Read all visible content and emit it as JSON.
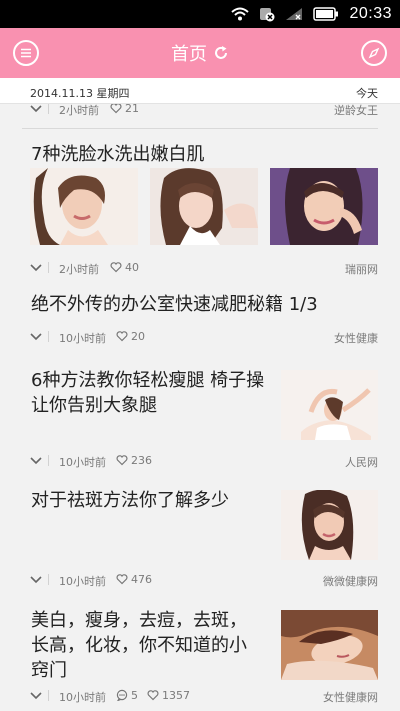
{
  "status_bar": {
    "time": "20:33",
    "icons": [
      "wifi-icon",
      "sim-off-icon",
      "signal-icon",
      "battery-icon"
    ]
  },
  "header": {
    "title": "首页",
    "left_icon": "menu-icon",
    "right_icon": "compass-icon",
    "refresh_icon": "refresh-icon",
    "background": "#f991b0"
  },
  "date_bar": {
    "date": "2014.11.13 星期四",
    "today": "今天"
  },
  "feed": [
    {
      "time": "2小时前",
      "likes": "21",
      "source": "逆龄女王"
    },
    {
      "title": "7种洗脸水洗出嫩白肌",
      "time": "2小时前",
      "likes": "40",
      "source": "瑞丽网"
    },
    {
      "title": "绝不外传的办公室快速减肥秘籍 1/3",
      "time": "10小时前",
      "likes": "20",
      "source": "女性健康"
    },
    {
      "title_line1": "6种方法教你轻松瘦腿 椅子操",
      "title_line2": "让你告别大象腿",
      "time": "10小时前",
      "likes": "236",
      "source": "人民网"
    },
    {
      "title": "对于祛斑方法你了解多少",
      "time": "10小时前",
      "likes": "476",
      "source": "微微健康网"
    },
    {
      "title_line1": "美白，瘦身，去痘，去斑，",
      "title_line2": "长高，化妆，你不知道的小",
      "title_line3": "窍门",
      "time": "10小时前",
      "comments": "5",
      "likes": "1357",
      "source": "女性健康网"
    }
  ]
}
